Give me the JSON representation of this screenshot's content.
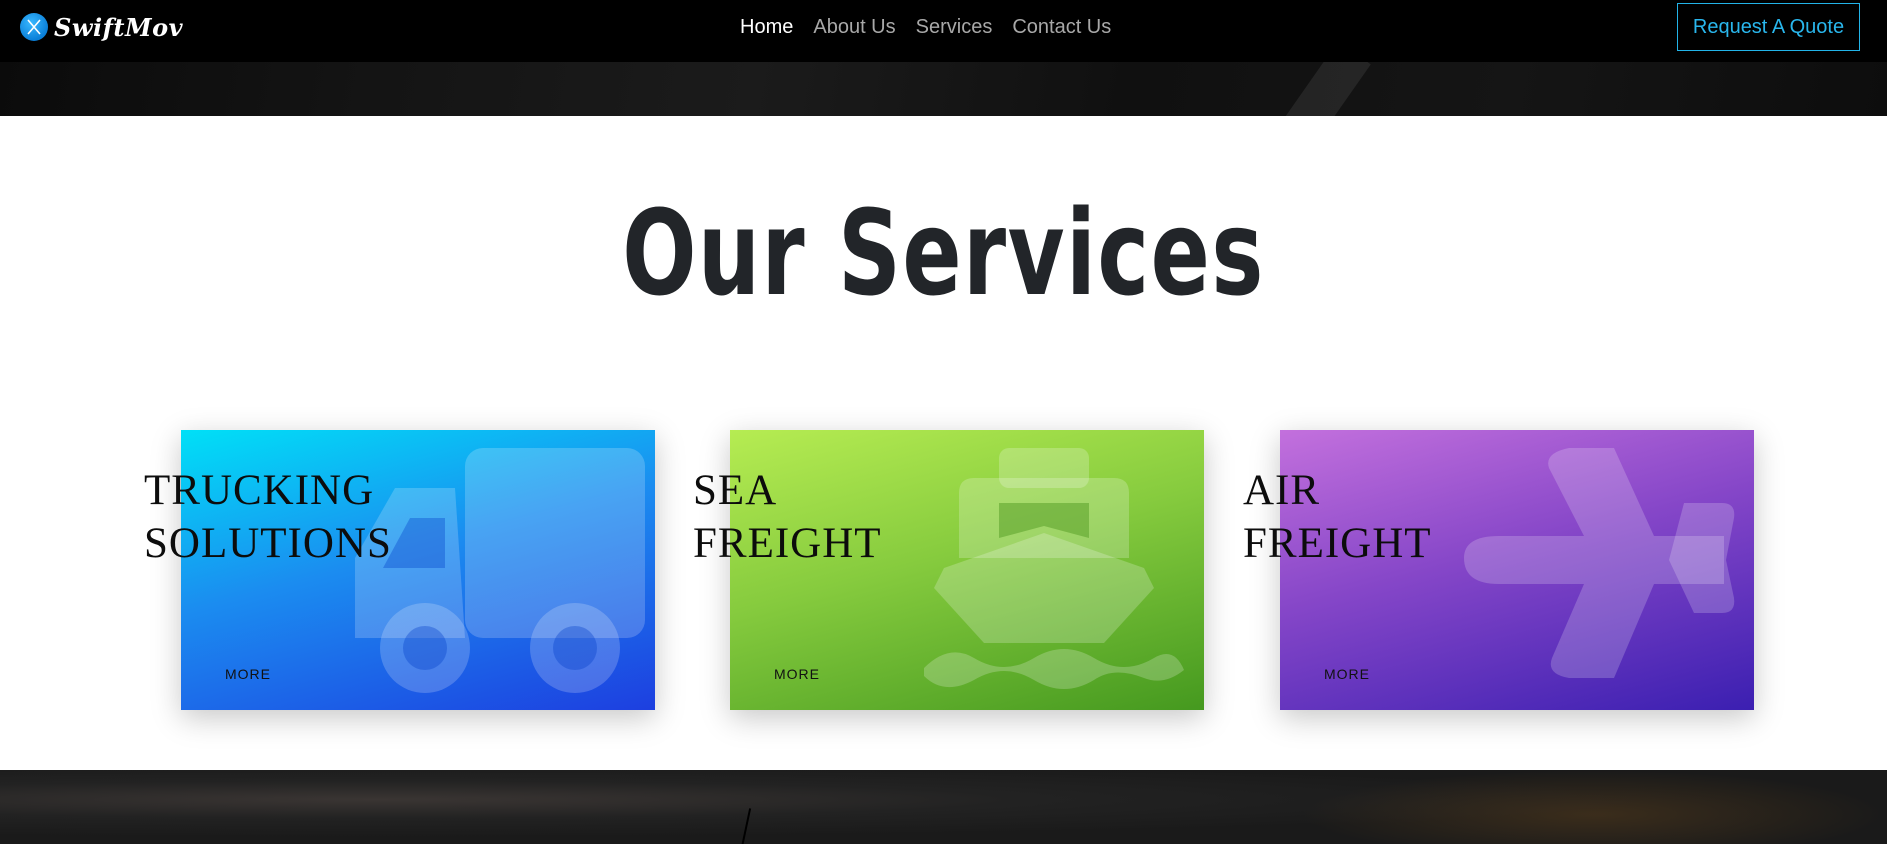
{
  "brand": {
    "name": "SwiftMov",
    "icon": "twitter-x-icon"
  },
  "nav": {
    "items": [
      {
        "label": "Home",
        "active": true
      },
      {
        "label": "About Us",
        "active": false
      },
      {
        "label": "Services",
        "active": false
      },
      {
        "label": "Contact Us",
        "active": false
      }
    ],
    "quote_button": "Request A Quote"
  },
  "services": {
    "title": "Our Services",
    "cards": [
      {
        "title_line1": "TRUCKING",
        "title_line2": "SOLUTIONS",
        "more": "MORE",
        "icon": "truck-icon",
        "gradient": [
          "#00e0f7",
          "#1d3fe0"
        ]
      },
      {
        "title_line1": "SEA",
        "title_line2": "FREIGHT",
        "more": "MORE",
        "icon": "ship-icon",
        "gradient": [
          "#b6ec52",
          "#45991f"
        ]
      },
      {
        "title_line1": "AIR",
        "title_line2": "FREIGHT",
        "more": "MORE",
        "icon": "airplane-icon",
        "gradient": [
          "#c370dd",
          "#3b1fb1"
        ]
      }
    ]
  },
  "colors": {
    "accent": "#29b6ec",
    "nav_bg": "#000000",
    "title": "#222529"
  }
}
